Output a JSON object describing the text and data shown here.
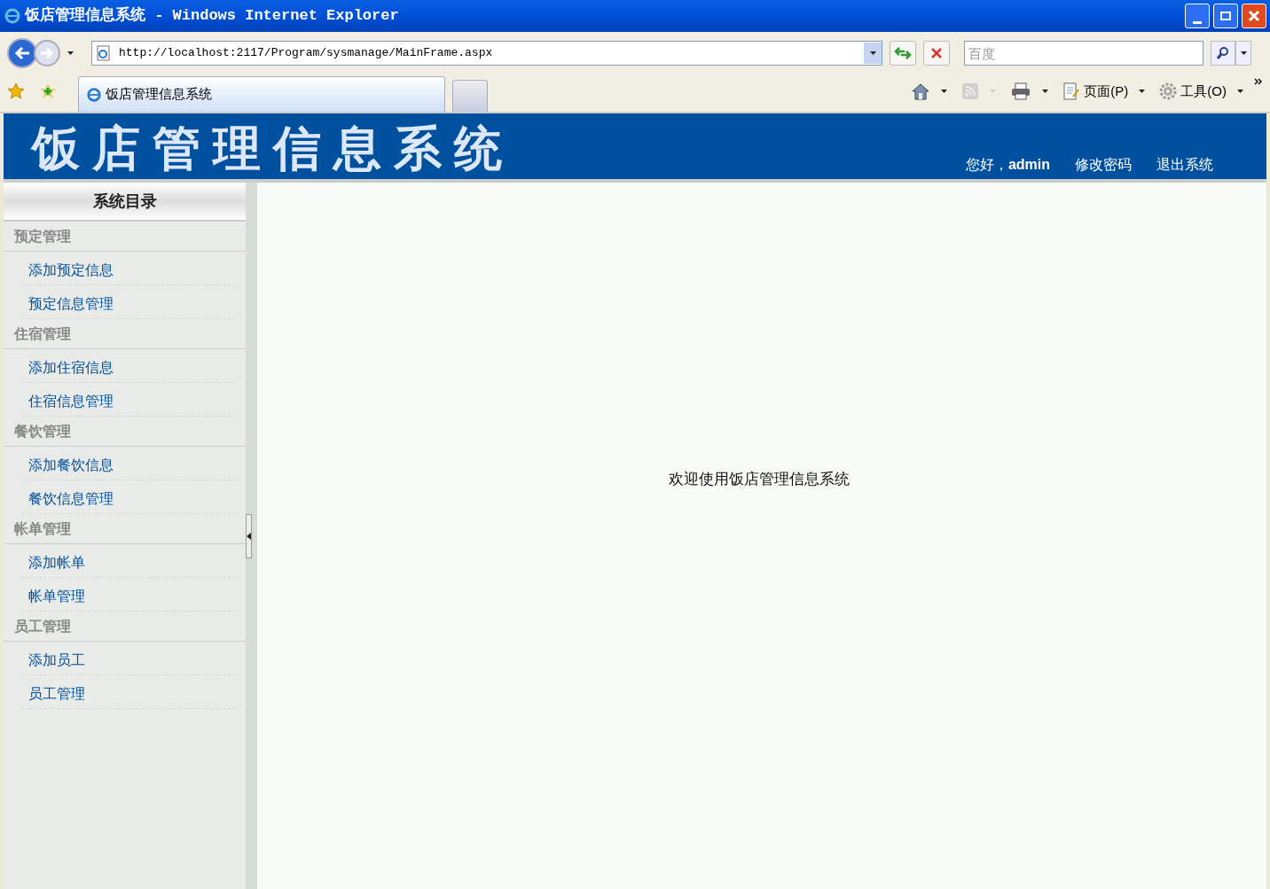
{
  "window": {
    "title": "饭店管理信息系统 - Windows Internet Explorer"
  },
  "address_bar": {
    "url": "http://localhost:2117/Program/sysmanage/MainFrame.aspx"
  },
  "search": {
    "placeholder": "百度"
  },
  "tabs": [
    {
      "label": "饭店管理信息系统",
      "selected": true
    }
  ],
  "toolbar": [
    {
      "kind": "home"
    },
    {
      "kind": "feed",
      "disabled": true
    },
    {
      "kind": "print"
    },
    {
      "kind": "page",
      "label": "页面(P)"
    },
    {
      "kind": "tools",
      "label": "工具(O)"
    }
  ],
  "header": {
    "title": "饭店管理信息系统",
    "greeting": "您好，**admin**",
    "links": [
      "修改密码",
      "退出系统"
    ]
  },
  "sidebar": {
    "title": "系统目录",
    "groups": [
      {
        "label": "预定管理",
        "items": [
          "添加预定信息",
          "预定信息管理"
        ]
      },
      {
        "label": "住宿管理",
        "items": [
          "添加住宿信息",
          "住宿信息管理"
        ]
      },
      {
        "label": "餐饮管理",
        "items": [
          "添加餐饮信息",
          "餐饮信息管理"
        ]
      },
      {
        "label": "帐单管理",
        "items": [
          "添加帐单",
          "帐单管理"
        ]
      },
      {
        "label": "员工管理",
        "items": [
          "添加员工",
          "员工管理"
        ]
      }
    ]
  },
  "content": {
    "message": "欢迎使用饭店管理信息系统"
  }
}
